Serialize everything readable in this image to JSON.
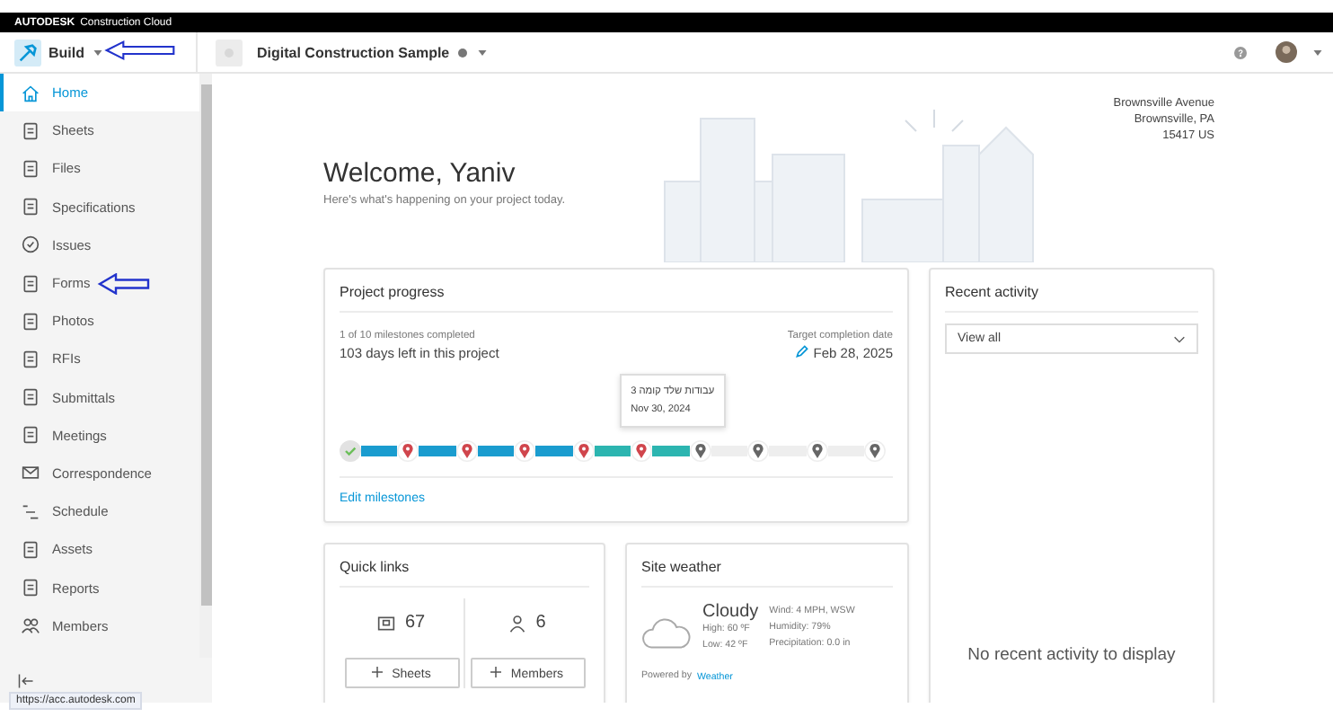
{
  "top_bar": {
    "brand": "AUTODESK",
    "product": "Construction Cloud"
  },
  "header": {
    "module": "Build",
    "project": "Digital Construction Sample"
  },
  "sidebar": {
    "items": [
      {
        "label": "Home",
        "selected": true
      },
      {
        "label": "Sheets",
        "selected": false
      },
      {
        "label": "Files",
        "selected": false
      },
      {
        "label": "Specifications",
        "selected": false
      },
      {
        "label": "Issues",
        "selected": false
      },
      {
        "label": "Forms",
        "selected": false
      },
      {
        "label": "Photos",
        "selected": false
      },
      {
        "label": "RFIs",
        "selected": false
      },
      {
        "label": "Submittals",
        "selected": false
      },
      {
        "label": "Meetings",
        "selected": false
      },
      {
        "label": "Correspondence",
        "selected": false
      },
      {
        "label": "Schedule",
        "selected": false
      },
      {
        "label": "Assets",
        "selected": false
      },
      {
        "label": "Reports",
        "selected": false
      },
      {
        "label": "Members",
        "selected": false
      }
    ]
  },
  "status_url": "https://acc.autodesk.com",
  "welcome": {
    "title": "Welcome, Yaniv",
    "subtitle": "Here's what's happening on your project today."
  },
  "address": [
    "Brownsville Avenue",
    "Brownsville, PA",
    "15417 US"
  ],
  "project_progress": {
    "title": "Project progress",
    "milestones_completed": "1 of 10 milestones completed",
    "days_left": "103 days left in this project",
    "target_label": "Target completion date",
    "target_date": "Feb 28, 2025",
    "milestones": [
      {
        "completed": true,
        "overdue": false
      },
      {
        "completed": false,
        "overdue": true
      },
      {
        "completed": false,
        "overdue": true
      },
      {
        "completed": false,
        "overdue": true
      },
      {
        "completed": false,
        "overdue": true
      },
      {
        "completed": false,
        "overdue": true
      },
      {
        "completed": false,
        "overdue": false,
        "tooltip": {
          "name": "עבודות שלד קומה 3",
          "date": "Nov 30, 2024"
        }
      },
      {
        "completed": false,
        "overdue": false
      },
      {
        "completed": false,
        "overdue": false
      },
      {
        "completed": false,
        "overdue": false
      }
    ],
    "edit_link": "Edit milestones"
  },
  "quick_links": {
    "title": "Quick links",
    "items": [
      {
        "count": "67",
        "button": "Sheets"
      },
      {
        "count": "6",
        "button": "Members"
      }
    ]
  },
  "site_weather": {
    "title": "Site weather",
    "condition": "Cloudy",
    "high": "High: 60 ºF",
    "low": "Low: 42 ºF",
    "wind": "Wind: 4 MPH, WSW",
    "humidity": "Humidity: 79%",
    "precipitation": "Precipitation: 0.0 in",
    "powered_by": "Powered by",
    "provider": "Weather"
  },
  "recent_activity": {
    "title": "Recent activity",
    "filter": "View all",
    "empty": "No recent activity to display"
  }
}
